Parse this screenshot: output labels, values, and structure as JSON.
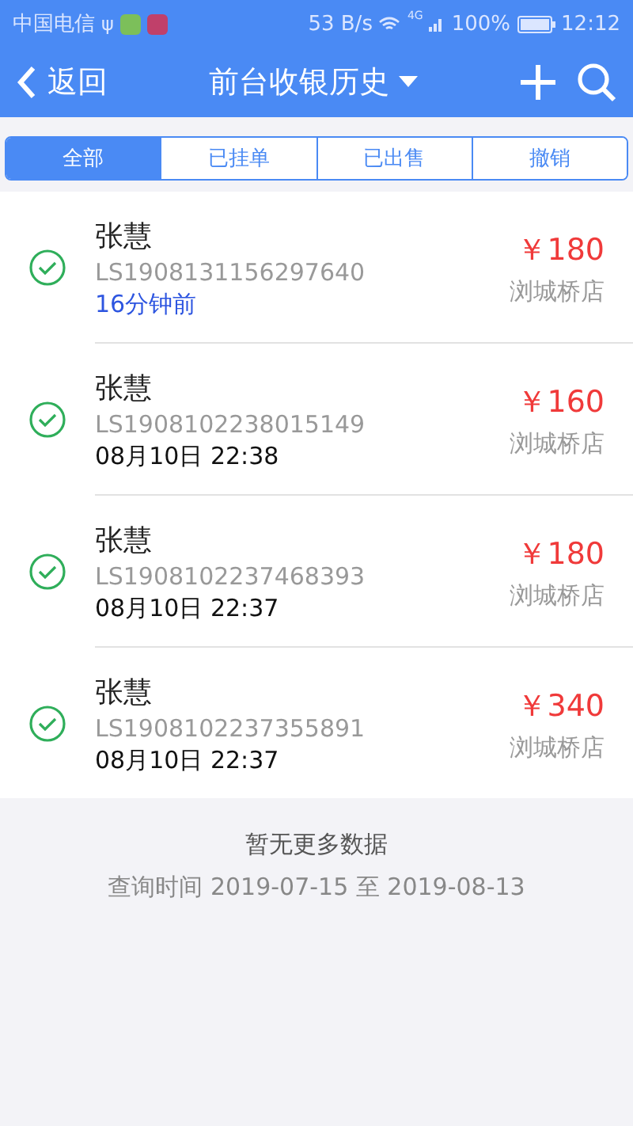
{
  "status_bar": {
    "carrier": "中国电信",
    "usb": "ψ",
    "speed": "53 B/s",
    "network": "4G",
    "battery": "100%",
    "time": "12:12"
  },
  "header": {
    "back": "返回",
    "title": "前台收银历史"
  },
  "tabs": [
    {
      "label": "全部",
      "selected": true
    },
    {
      "label": "已挂单",
      "selected": false
    },
    {
      "label": "已出售",
      "selected": false
    },
    {
      "label": "撤销",
      "selected": false
    }
  ],
  "records": [
    {
      "name": "张慧",
      "order_no": "LS1908131156297640",
      "time": "16分钟前",
      "kind": "relative",
      "amount": "￥180",
      "store": "浏城桥店"
    },
    {
      "name": "张慧",
      "order_no": "LS1908102238015149",
      "time": "08月10日 22:38",
      "kind": "absolute",
      "amount": "￥160",
      "store": "浏城桥店"
    },
    {
      "name": "张慧",
      "order_no": "LS1908102237468393",
      "time": "08月10日 22:37",
      "kind": "absolute",
      "amount": "￥180",
      "store": "浏城桥店"
    },
    {
      "name": "张慧",
      "order_no": "LS1908102237355891",
      "time": "08月10日 22:37",
      "kind": "absolute",
      "amount": "￥340",
      "store": "浏城桥店"
    }
  ],
  "footer": {
    "message": "暂无更多数据",
    "range": "查询时间 2019-07-15 至 2019-08-13"
  }
}
